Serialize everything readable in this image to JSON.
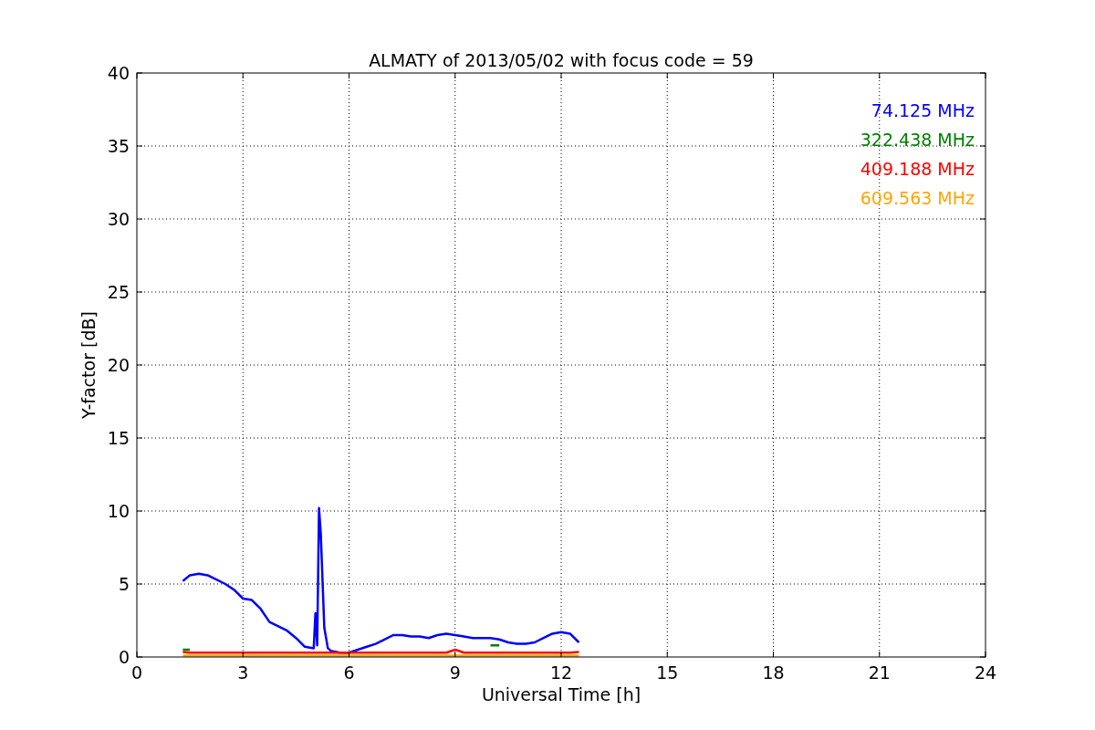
{
  "chart_data": {
    "type": "line",
    "title": "ALMATY of 2013/05/02 with focus code = 59",
    "xlabel": "Universal Time [h]",
    "ylabel": "Y-factor [dB]",
    "xlim": [
      0,
      24
    ],
    "ylim": [
      0,
      40
    ],
    "xticks": [
      0,
      3,
      6,
      9,
      12,
      15,
      18,
      21,
      24
    ],
    "yticks": [
      0,
      5,
      10,
      15,
      20,
      25,
      30,
      35,
      40
    ],
    "grid": true,
    "x": [
      1.3,
      1.5,
      1.75,
      2,
      2.25,
      2.5,
      2.75,
      3,
      3.25,
      3.5,
      3.75,
      4,
      4.25,
      4.5,
      4.75,
      5,
      5.05,
      5.1,
      5.15,
      5.2,
      5.3,
      5.4,
      5.5,
      5.75,
      6,
      6.25,
      6.5,
      6.75,
      7,
      7.25,
      7.5,
      7.75,
      8,
      8.25,
      8.5,
      8.75,
      9,
      9.25,
      9.5,
      9.75,
      10,
      10.25,
      10.5,
      10.75,
      11,
      11.25,
      11.5,
      11.75,
      12,
      12.25,
      12.5
    ],
    "series": [
      {
        "name": "74.125 MHz",
        "color": "#0000ff",
        "values": [
          5.2,
          5.6,
          5.7,
          5.6,
          5.3,
          5.0,
          4.6,
          4.0,
          3.9,
          3.3,
          2.4,
          2.1,
          1.8,
          1.3,
          0.7,
          0.6,
          3.0,
          0.8,
          10.2,
          8.5,
          2.0,
          0.6,
          0.4,
          0.3,
          0.3,
          0.5,
          0.7,
          0.9,
          1.2,
          1.5,
          1.5,
          1.4,
          1.4,
          1.3,
          1.5,
          1.6,
          1.5,
          1.4,
          1.3,
          1.3,
          1.3,
          1.2,
          1.0,
          0.9,
          0.9,
          1.0,
          1.3,
          1.6,
          1.7,
          1.6,
          1.0
        ]
      },
      {
        "name": "322.438 MHz",
        "color": "#008000",
        "values": [
          0.5,
          0.5,
          null,
          null,
          null,
          null,
          null,
          null,
          null,
          null,
          null,
          null,
          null,
          null,
          null,
          null,
          null,
          null,
          null,
          null,
          null,
          null,
          null,
          null,
          null,
          null,
          null,
          null,
          null,
          null,
          null,
          null,
          null,
          null,
          null,
          null,
          null,
          null,
          null,
          null,
          0.8,
          0.8,
          null,
          null,
          null,
          null,
          null,
          null,
          null,
          null,
          null
        ]
      },
      {
        "name": "409.188 MHz",
        "color": "#ff0000",
        "values": [
          0.35,
          0.3,
          0.3,
          0.3,
          0.3,
          0.3,
          0.3,
          0.3,
          0.3,
          0.3,
          0.3,
          0.3,
          0.3,
          0.3,
          0.3,
          0.3,
          0.3,
          0.3,
          0.3,
          0.3,
          0.3,
          0.3,
          0.3,
          0.3,
          0.3,
          0.3,
          0.3,
          0.3,
          0.3,
          0.3,
          0.3,
          0.3,
          0.3,
          0.3,
          0.3,
          0.3,
          0.5,
          0.3,
          0.3,
          0.3,
          0.3,
          0.3,
          0.3,
          0.3,
          0.3,
          0.3,
          0.3,
          0.3,
          0.3,
          0.3,
          0.35
        ]
      },
      {
        "name": "609.563 MHz",
        "color": "#ffa500",
        "values": [
          0.1,
          0.1,
          0.1,
          0.1,
          0.1,
          0.1,
          0.1,
          0.1,
          0.1,
          0.1,
          0.1,
          0.1,
          0.1,
          0.1,
          0.1,
          0.1,
          0.1,
          0.1,
          0.1,
          0.1,
          0.1,
          0.1,
          0.1,
          0.1,
          0.1,
          0.1,
          0.1,
          0.1,
          0.1,
          0.1,
          0.1,
          0.1,
          0.1,
          0.1,
          0.1,
          0.1,
          0.1,
          0.1,
          0.1,
          0.1,
          0.1,
          0.1,
          0.1,
          0.1,
          0.1,
          0.1,
          0.1,
          0.1,
          0.1,
          0.1,
          0.1
        ]
      }
    ]
  }
}
